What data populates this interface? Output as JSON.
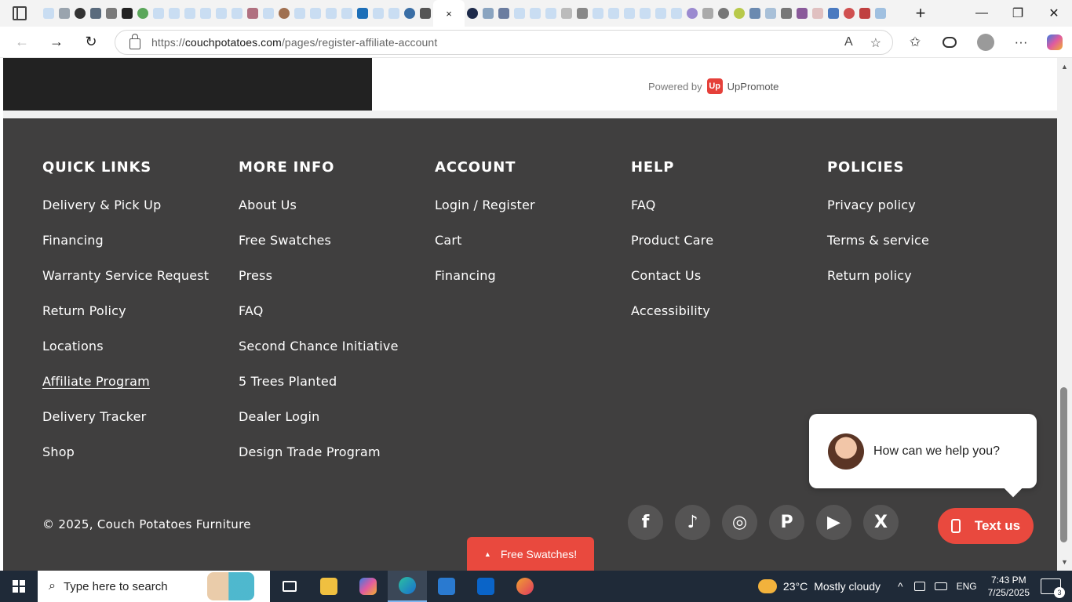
{
  "browser": {
    "url_prefix": "https://",
    "url_domain": "couchpotatoes.com",
    "url_path": "/pages/register-affiliate-account",
    "tab_close": "×",
    "back": "←",
    "forward": "→",
    "refresh": "↻",
    "new_tab": "+",
    "minimize": "—",
    "restore": "❐",
    "close": "✕",
    "read_aloud": "A",
    "favorite_star": "☆",
    "favorites": "✩",
    "more": "···"
  },
  "page": {
    "powered_by": "Powered by",
    "powered_brand": "UpPromote",
    "powered_logo": "Up",
    "footer": {
      "columns": [
        {
          "heading": "QUICK LINKS",
          "links": [
            "Delivery & Pick Up",
            "Financing",
            "Warranty Service Request",
            "Return Policy",
            "Locations",
            "Affiliate Program",
            "Delivery Tracker",
            "Shop"
          ]
        },
        {
          "heading": "MORE INFO",
          "links": [
            "About Us",
            "Free Swatches",
            "Press",
            "FAQ",
            "Second Chance Initiative",
            "5 Trees Planted",
            "Dealer Login",
            "Design Trade Program"
          ]
        },
        {
          "heading": "ACCOUNT",
          "links": [
            "Login / Register",
            "Cart",
            "Financing"
          ]
        },
        {
          "heading": "HELP",
          "links": [
            "FAQ",
            "Product Care",
            "Contact Us",
            "Accessibility"
          ]
        },
        {
          "heading": "POLICIES",
          "links": [
            "Privacy policy",
            "Terms & service",
            "Return policy"
          ]
        }
      ],
      "copyright": "© 2025, Couch Potatoes Furniture",
      "socials": [
        {
          "name": "facebook-icon",
          "glyph": "f"
        },
        {
          "name": "tiktok-icon",
          "glyph": "♪"
        },
        {
          "name": "instagram-icon",
          "glyph": "◎"
        },
        {
          "name": "pinterest-icon",
          "glyph": "P"
        },
        {
          "name": "youtube-icon",
          "glyph": "▶"
        },
        {
          "name": "x-icon",
          "glyph": "X"
        }
      ]
    },
    "chat_bubble": "How can we help you?",
    "text_us": "Text us",
    "free_swatches": "Free Swatches!",
    "caret": "▲"
  },
  "taskbar": {
    "search_placeholder": "Type here to search",
    "weather_temp": "23°C",
    "weather_desc": "Mostly cloudy",
    "language": "ENG",
    "time": "7:43 PM",
    "date": "7/25/2025",
    "notif_count": "3",
    "tray_chevron": "^"
  },
  "colors": {
    "footer_bg": "#403f3f",
    "accent_red": "#e9493e",
    "taskbar_bg": "#1f2a38"
  }
}
